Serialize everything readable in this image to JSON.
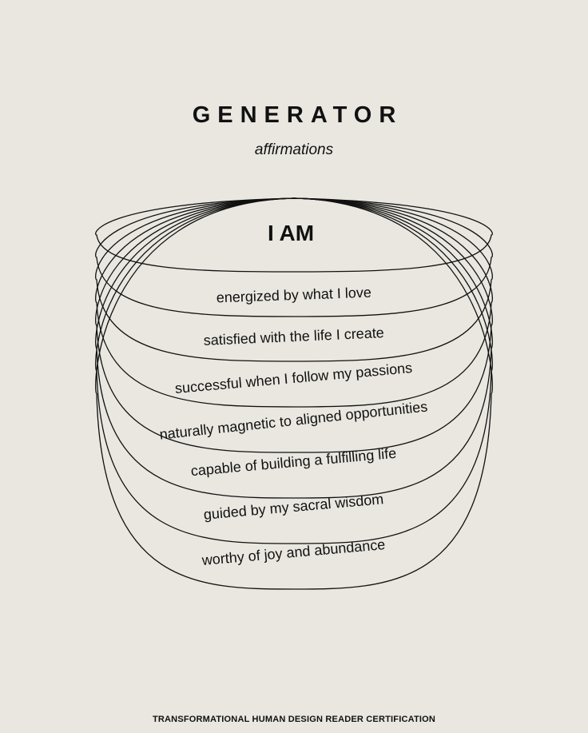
{
  "poster": {
    "title": "GENERATOR",
    "subtitle": "affirmations",
    "heading": "I AM",
    "footer": "TRANSFORMATIONAL HUMAN DESIGN READER CERTIFICATION"
  },
  "affirmations": [
    "energized by what I love",
    "satisfied with the life I create",
    "successful when I follow my passions",
    "naturally magnetic to aligned opportunities",
    "capable of building a fulfilling life",
    "guided by my sacral wisdom",
    "worthy of joy and abundance"
  ],
  "colors": {
    "background": "#e9e7e0",
    "ink": "#111111"
  }
}
